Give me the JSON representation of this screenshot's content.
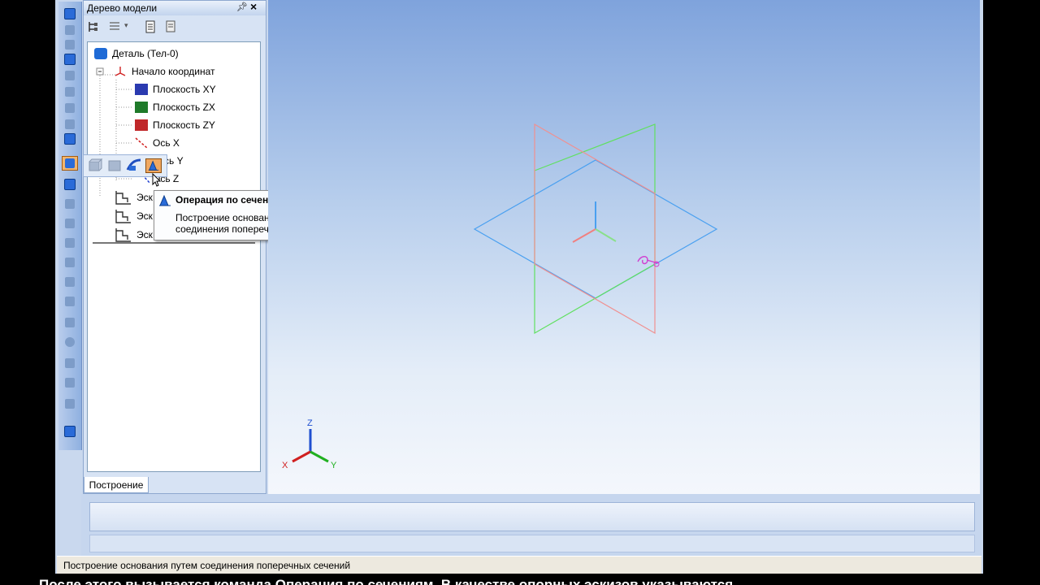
{
  "tree_panel": {
    "title": "Дерево модели",
    "pin_glyph": "ᵖ",
    "close_glyph": "×",
    "nodes": [
      {
        "label": "Деталь (Тел-0)",
        "icon": "part-icon"
      },
      {
        "label": "Начало координат",
        "icon": "origin-icon"
      },
      {
        "label": "Плоскость XY",
        "icon": "plane-xy-icon"
      },
      {
        "label": "Плоскость ZX",
        "icon": "plane-zx-icon"
      },
      {
        "label": "Плоскость ZY",
        "icon": "plane-zy-icon"
      },
      {
        "label": "Ось X",
        "icon": "axis-x-icon"
      },
      {
        "label": "сь Y",
        "icon": "axis-y-icon"
      },
      {
        "label": "Ось Z",
        "icon": "axis-z-icon"
      },
      {
        "label": "Эск",
        "icon": "sketch-icon"
      },
      {
        "label": "Эск",
        "icon": "sketch-icon"
      },
      {
        "label": "Эск",
        "icon": "sketch-icon"
      }
    ],
    "tab_label": "Построение"
  },
  "tooltip": {
    "title": "Операция по сечениям",
    "description": "Построение основания путем соединения поперечных сечений"
  },
  "triad": {
    "x": "X",
    "y": "Y",
    "z": "Z"
  },
  "status_text": "Построение основания путем соединения поперечных сечений",
  "subtitle": "После этого вызывается команда Операция по сечениям. В качестве опорных эскизов указываются",
  "colors": {
    "plane_xy": "#4aa0f0",
    "plane_zx": "#60e060",
    "plane_zy": "#f09090",
    "selected_button": "#f0a860",
    "accent": "#2a6bd8"
  }
}
